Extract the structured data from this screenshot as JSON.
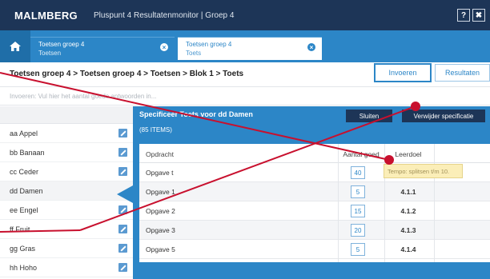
{
  "header": {
    "logo": "MALMBERG",
    "app_title": "Pluspunt 4 Resultatenmonitor  |  Groep 4",
    "help_label": "?",
    "close_label": "✖"
  },
  "tabs": [
    {
      "title": "Toetsen groep 4",
      "subtitle": "Toetsen"
    },
    {
      "title": "Toetsen groep 4",
      "subtitle": "Toets"
    }
  ],
  "breadcrumb": "Toetsen groep 4 > Toetsen groep 4 > Toetsen > Blok 1 > Toets",
  "buttons": {
    "invoeren": "Invoeren",
    "resultaten": "Resultaten"
  },
  "instruction": "Invoeren: Vul hier het aantal goede antwoorden in...",
  "students": [
    "aa Appel",
    "bb Banaan",
    "cc Ceder",
    "dd Damen",
    "ee Engel",
    "ff Fruit",
    "gg Gras",
    "hh Hoho"
  ],
  "panel": {
    "title": "Specificeer Toets voor dd Damen",
    "count": "(85 ITEMS)",
    "close_button": "Sluiten",
    "delete_button": "Verwijder specificatie",
    "columns": {
      "opdracht": "Opdracht",
      "aantal_goed": "Aantal goed",
      "leerdoel": "Leerdoel"
    },
    "rows": [
      {
        "opdracht": "Opgave t",
        "aantal": "40",
        "leerdoel": ""
      },
      {
        "opdracht": "Opgave 1",
        "aantal": "5",
        "leerdoel": "4.1.1"
      },
      {
        "opdracht": "Opgave 2",
        "aantal": "15",
        "leerdoel": "4.1.2"
      },
      {
        "opdracht": "Opgave 3",
        "aantal": "20",
        "leerdoel": "4.1.3"
      },
      {
        "opdracht": "Opgave 5",
        "aantal": "5",
        "leerdoel": "4.1.4"
      }
    ]
  },
  "tooltip": "Tempo: splitsen t/m 10.",
  "colors": {
    "navy": "#1d3557",
    "blue": "#2c86c7",
    "annotation": "#c8102e"
  }
}
